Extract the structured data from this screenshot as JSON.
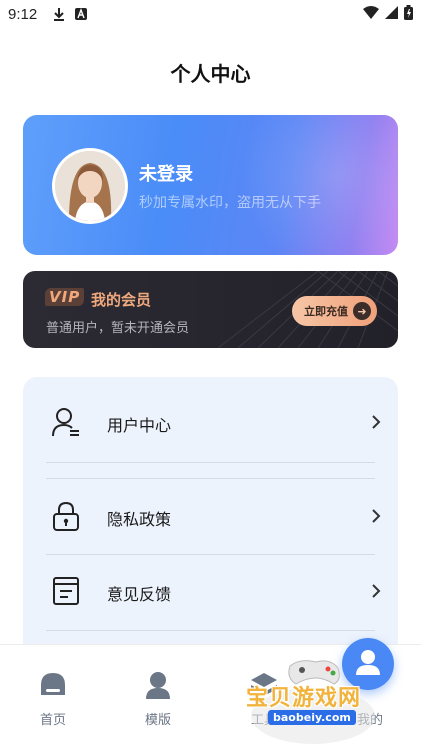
{
  "status_bar": {
    "time": "9:12"
  },
  "page": {
    "title": "个人中心"
  },
  "profile": {
    "name": "未登录",
    "subtitle": "秒加专属水印，盗用无从下手"
  },
  "vip": {
    "badge": "VIP",
    "title": "我的会员",
    "description": "普通用户，暂未开通会员",
    "button_label": "立即充值"
  },
  "menu": {
    "items": [
      {
        "label": "用户中心",
        "icon": "user-icon"
      },
      {
        "label": "隐私政策",
        "icon": "lock-icon"
      },
      {
        "label": "意见反馈",
        "icon": "feedback-icon"
      }
    ]
  },
  "tabbar": {
    "tabs": [
      {
        "label": "首页",
        "icon": "home-icon"
      },
      {
        "label": "模版",
        "icon": "template-icon"
      },
      {
        "label": "工具",
        "icon": "tools-icon"
      },
      {
        "label": "我的",
        "icon": "profile-icon"
      }
    ]
  },
  "watermark": {
    "text": "宝贝游戏网",
    "url": "baobeiy.com"
  },
  "colors": {
    "accent": "#4a89f5",
    "vip_gold": "#f0a97d",
    "menu_panel": "#edf3fd"
  }
}
